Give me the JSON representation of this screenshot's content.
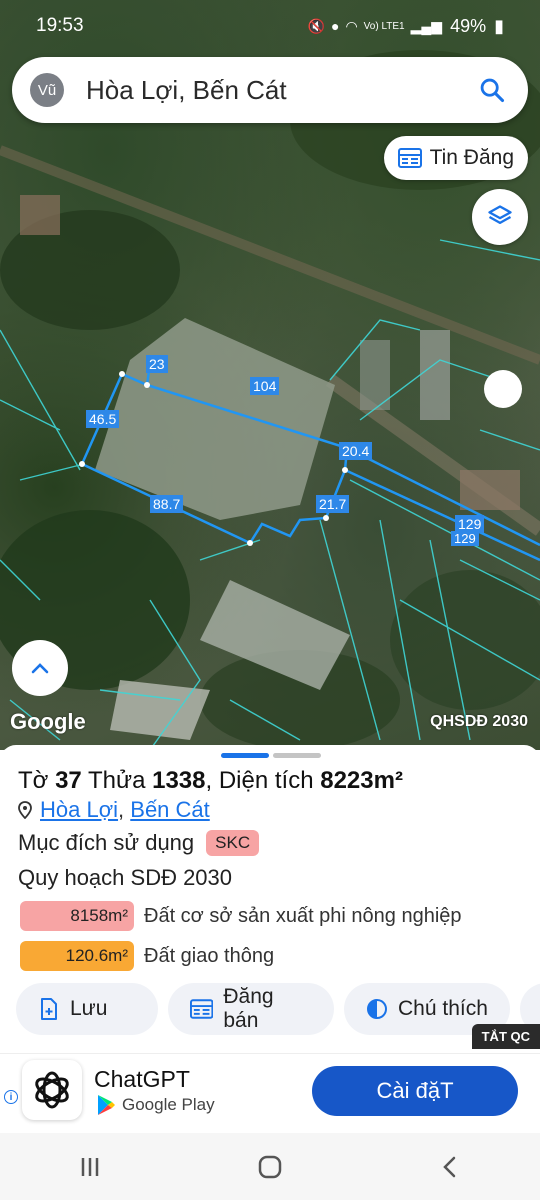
{
  "status_bar": {
    "time": "19:53",
    "battery": "49%",
    "network": "Vo) LTE1"
  },
  "search": {
    "avatar": "Vũ",
    "query": "Hòa Lợi, Bến Cát",
    "icon": "search-icon"
  },
  "map": {
    "tin_dang_label": "Tin Đăng",
    "attribution": "Google",
    "layer_label": "QHSDĐ 2030",
    "edge_labels": [
      "23",
      "104",
      "46.5",
      "20.4",
      "88.7",
      "21.7",
      "129",
      "129"
    ]
  },
  "sheet": {
    "title_prefix": "Tờ",
    "to_number": "37",
    "thua_label": "Thửa",
    "thua_number": "1338",
    "area_label": ", Diện tích",
    "area_value": "8223m²",
    "location_ward": "Hòa Lợi",
    "location_district": "Bến Cát",
    "purpose_label": "Mục đích sử dụng",
    "purpose_code": "SKC",
    "plan_label": "Quy hoạch SDĐ 2030",
    "legend": [
      {
        "area": "8158m²",
        "desc": "Đất cơ sở sản xuất phi nông nghiệp",
        "color": "#f7a4a4"
      },
      {
        "area": "120.6m²",
        "desc": "Đất giao thông",
        "color": "#f9a834"
      }
    ],
    "actions": [
      {
        "label": "Lưu",
        "icon": "add-file-icon"
      },
      {
        "label": "Đăng bán",
        "icon": "calendar-icon"
      },
      {
        "label": "Chú thích",
        "icon": "contrast-icon"
      }
    ]
  },
  "ad": {
    "close_label": "TẮT QC",
    "app_name": "ChatGPT",
    "store": "Google Play",
    "install_label": "Cài đặT"
  }
}
